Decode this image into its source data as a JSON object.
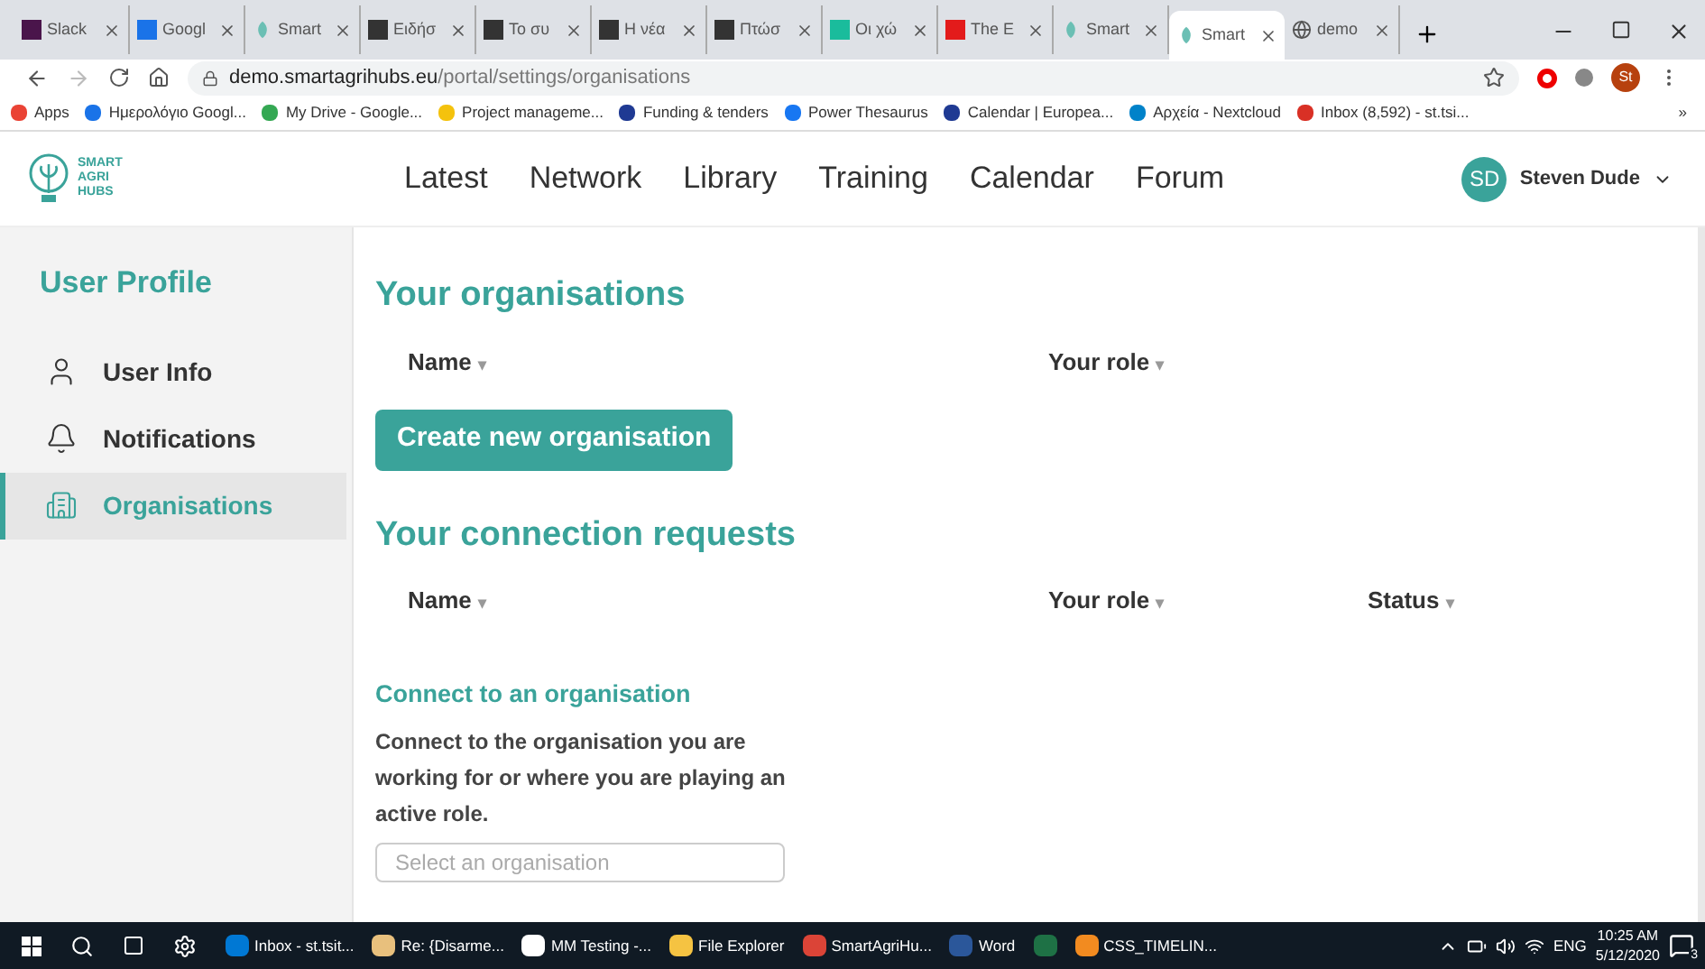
{
  "browser": {
    "tabs": [
      {
        "title": "Slack",
        "kind": "square",
        "color": "#4a154b",
        "selected": false
      },
      {
        "title": "Googl",
        "kind": "square",
        "color": "#1a73e8",
        "selected": false
      },
      {
        "title": "Smart",
        "kind": "leaf",
        "selected": false
      },
      {
        "title": "Ειδήσ",
        "kind": "square",
        "color": "#333333",
        "selected": false
      },
      {
        "title": "Το συ",
        "kind": "square",
        "color": "#333333",
        "selected": false
      },
      {
        "title": "Η νέα",
        "kind": "square",
        "color": "#333333",
        "selected": false
      },
      {
        "title": "Πτώσ",
        "kind": "square",
        "color": "#333333",
        "selected": false
      },
      {
        "title": "Οι χώ",
        "kind": "square",
        "color": "#1abc9c",
        "selected": false
      },
      {
        "title": "The E",
        "kind": "square",
        "color": "#e31b1b",
        "selected": false
      },
      {
        "title": "Smart",
        "kind": "leaf",
        "selected": false
      },
      {
        "title": "Smart",
        "kind": "leaf",
        "selected": true
      },
      {
        "title": "demo",
        "kind": "globe",
        "selected": false
      }
    ],
    "address": {
      "domain": "demo.smartagrihubs.eu",
      "path": "/portal/settings/organisations"
    },
    "profile_initials": "St",
    "bookmarks": [
      {
        "label": "Apps",
        "color": "#ea4335"
      },
      {
        "label": "Ημερολόγιο Googl...",
        "color": "#1a73e8"
      },
      {
        "label": "My Drive - Google...",
        "color": "#34a853"
      },
      {
        "label": "Project manageme...",
        "color": "#f4c20d"
      },
      {
        "label": "Funding & tenders",
        "color": "#1f3a93"
      },
      {
        "label": "Power Thesaurus",
        "color": "#1877f2"
      },
      {
        "label": "Calendar | Europea...",
        "color": "#1f3a93"
      },
      {
        "label": "Αρχεία - Nextcloud",
        "color": "#0082c9"
      },
      {
        "label": "Inbox (8,592) - st.tsi...",
        "color": "#d93025"
      }
    ],
    "overflow": "»"
  },
  "site": {
    "logo_lines": [
      "SMART",
      "AGRI",
      "HUBS"
    ],
    "nav": [
      "Latest",
      "Network",
      "Library",
      "Training",
      "Calendar",
      "Forum"
    ],
    "user": {
      "initials": "SD",
      "name": "Steven Dude"
    }
  },
  "sidebar": {
    "title": "User Profile",
    "items": [
      {
        "label": "User Info",
        "kind": "user",
        "selected": false
      },
      {
        "label": "Notifications",
        "kind": "bell",
        "selected": false
      },
      {
        "label": "Organisations",
        "kind": "building",
        "selected": true
      }
    ]
  },
  "content": {
    "organisations": {
      "title": "Your organisations",
      "columns": [
        {
          "label": "Name",
          "sort": "▾"
        },
        {
          "label": "Your role",
          "sort": "▾"
        }
      ],
      "button": "Create new organisation"
    },
    "requests": {
      "title": "Your connection requests",
      "columns": [
        {
          "label": "Name",
          "sort": "▾"
        },
        {
          "label": "Your role",
          "sort": "▾"
        },
        {
          "label": "Status",
          "sort": "▾"
        }
      ]
    },
    "connect": {
      "title": "Connect to an organisation",
      "text": "Connect to the organisation you are working for or where you are playing an active role.",
      "placeholder": "Select an organisation"
    }
  },
  "taskbar": {
    "apps": [
      {
        "label": "Inbox - st.tsit...",
        "color": "#0078d4"
      },
      {
        "label": "Re: {Disarme...",
        "color": "#e8c07d"
      },
      {
        "label": "MM Testing -...",
        "color": "#ffffff"
      },
      {
        "label": "File Explorer",
        "color": "#f5c342"
      },
      {
        "label": "SmartAgriHu...",
        "color": "#db4437"
      },
      {
        "label": "Word",
        "color": "#2b579a"
      },
      {
        "color": "#1e7145"
      },
      {
        "label": "CSS_TIMELIN...",
        "color": "#f28b20"
      }
    ],
    "language": "ENG",
    "time": "10:25 AM",
    "date": "5/12/2020",
    "notifications": "3"
  }
}
